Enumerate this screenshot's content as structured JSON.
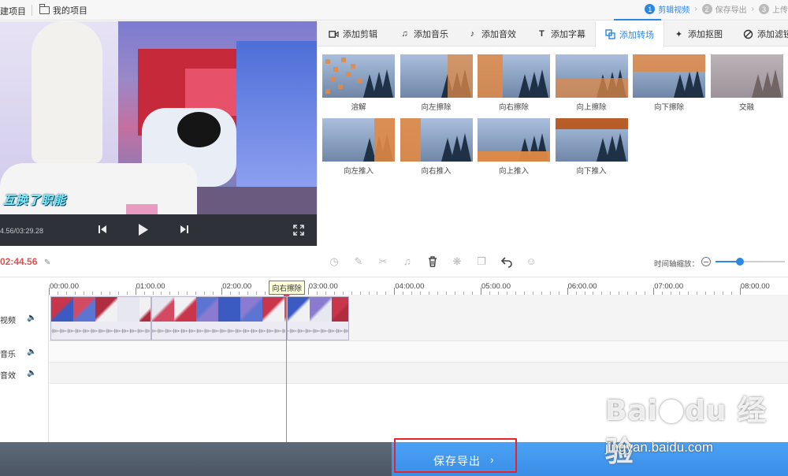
{
  "topbar": {
    "new_project": "建项目",
    "my_projects": "我的项目",
    "steps": [
      {
        "num": "1",
        "label": "剪辑视频"
      },
      {
        "num": "2",
        "label": "保存导出"
      },
      {
        "num": "3",
        "label": "上传"
      }
    ]
  },
  "player": {
    "caption": "互换了职能",
    "time": "4.56/03:29.28"
  },
  "tabs": [
    {
      "label": "添加剪辑",
      "icon": "video-camera-icon"
    },
    {
      "label": "添加音乐",
      "icon": "music-note-icon"
    },
    {
      "label": "添加音效",
      "icon": "sound-effect-icon"
    },
    {
      "label": "添加字幕",
      "icon": "text-icon"
    },
    {
      "label": "添加转场",
      "icon": "transition-icon"
    },
    {
      "label": "添加抠图",
      "icon": "cutout-icon"
    },
    {
      "label": "添加滤镜",
      "icon": "filter-icon"
    }
  ],
  "transitions": [
    {
      "label": "溶解",
      "type": "dissolve"
    },
    {
      "label": "向左擦除",
      "type": "wipe-left"
    },
    {
      "label": "向右擦除",
      "type": "wipe-right"
    },
    {
      "label": "向上擦除",
      "type": "wipe-up"
    },
    {
      "label": "向下擦除",
      "type": "wipe-down"
    },
    {
      "label": "交融",
      "type": "blend"
    },
    {
      "label": "向左推入",
      "type": "push-left"
    },
    {
      "label": "向右推入",
      "type": "push-right"
    },
    {
      "label": "向上推入",
      "type": "push-up"
    },
    {
      "label": "向下推入",
      "type": "push-down"
    }
  ],
  "timeline": {
    "current_time": "02:44.56",
    "zoom_label": "时间轴缩放：",
    "zoom_level": 0.35,
    "ruler": [
      "00:00.00",
      "01:00.00",
      "02:00.00",
      "03:00.00",
      "04:00.00",
      "05:00.00",
      "06:00.00",
      "07:00.00",
      "08:00.00"
    ],
    "tracks": [
      {
        "label": "视频"
      },
      {
        "label": "音乐"
      },
      {
        "label": "音效"
      }
    ],
    "tooltip": "向右擦除"
  },
  "bottom": {
    "save_label": "保存导出"
  },
  "watermark": {
    "url": "jingyan.baidu.com"
  },
  "colors": {
    "accent": "#2e86e6",
    "playhead": "#e06a92",
    "highlight_box": "#e6242a",
    "time_red": "#e35050"
  }
}
